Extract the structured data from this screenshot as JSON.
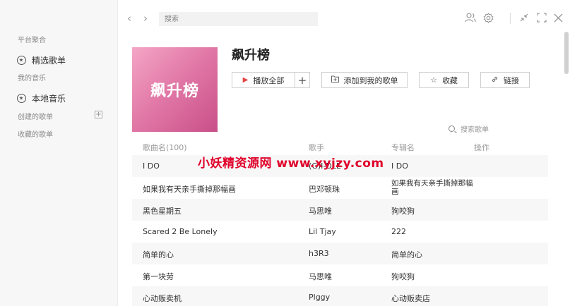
{
  "sidebar": {
    "section_platform": "平台聚合",
    "item_featured": "精选歌单",
    "section_my_music": "我的音乐",
    "item_local": "本地音乐",
    "section_created": "创建的歌单",
    "add_symbol": "+",
    "section_collected": "收藏的歌单"
  },
  "topbar": {
    "back": "‹",
    "forward": "›",
    "search_placeholder": "搜索"
  },
  "playlist": {
    "cover_text": "飙升榜",
    "title": "飙升榜",
    "play_all": "播放全部",
    "play_plus": "+",
    "add_to": "添加到我的歌单",
    "favorite": "收藏",
    "link": "链接",
    "search_songs": "搜索歌单"
  },
  "table": {
    "headers": [
      "歌曲名(100)",
      "歌手",
      "专辑名",
      "操作"
    ],
    "rows": [
      {
        "song": "I DO",
        "artist": "(G)I-DLE",
        "album": "I DO"
      },
      {
        "song": "如果我有天亲手撕掉那幅画",
        "artist": "巴邓顿珠",
        "album": "如果我有天亲手撕掉那幅画"
      },
      {
        "song": "黑色星期五",
        "artist": "马思唯",
        "album": "狗咬狗"
      },
      {
        "song": "Scared 2 Be Lonely",
        "artist": "Lil Tjay",
        "album": "222"
      },
      {
        "song": "简单的心",
        "artist": "h3R3",
        "album": "简单的心"
      },
      {
        "song": "第一块劳",
        "artist": "马思唯",
        "album": "狗咬狗"
      },
      {
        "song": "心动贩卖机",
        "artist": "Plggy",
        "album": "心动贩卖店"
      }
    ]
  },
  "watermark": "小妖精资源网 www.xyjzy.com",
  "colors": {
    "accent_red": "#e54646",
    "cover_pink": "#e27aa8",
    "watermark_red": "#e0002a"
  }
}
